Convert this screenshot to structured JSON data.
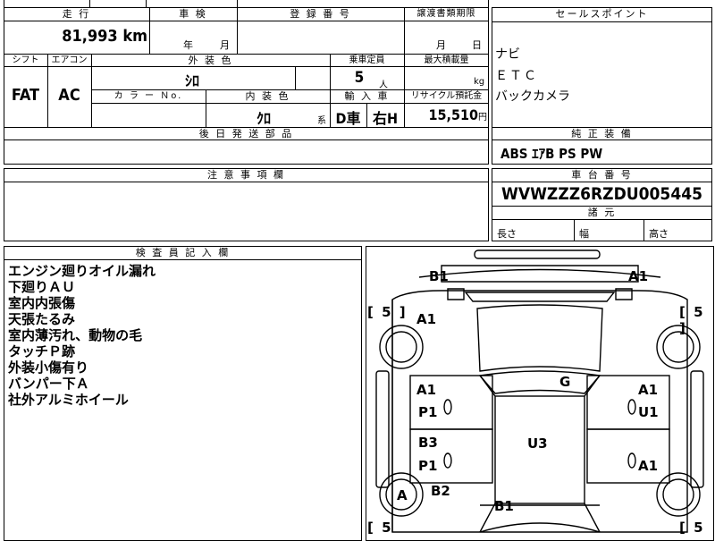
{
  "mileage": {
    "header": "走 行",
    "value": "81,993",
    "unit": "km"
  },
  "inspection": {
    "header": "車 検",
    "year_unit": "年",
    "month_unit": "月"
  },
  "registration": {
    "header": "登 録 番 号"
  },
  "transfer": {
    "header": "譲渡書類期限",
    "month_unit": "月",
    "day_unit": "日"
  },
  "shift": {
    "header": "シフト",
    "value": "FAT"
  },
  "aircon": {
    "header": "エアコン",
    "value": "AC"
  },
  "exterior_color": {
    "header": "外 装 色",
    "value": "ｼﾛ"
  },
  "capacity": {
    "header": "乗車定員",
    "value": "5",
    "unit": "人"
  },
  "max_load": {
    "header": "最大積載量",
    "unit": "kg"
  },
  "color_no": {
    "header": "カ ラ ー Ｎo."
  },
  "interior_color": {
    "header": "内 装 色",
    "value": "ｸﾛ",
    "suffix": "系"
  },
  "import_car": {
    "header": "輸 入 車",
    "value1": "D車",
    "value2": "右H"
  },
  "recycle": {
    "header": "リサイクル預託金",
    "value": "15,510",
    "unit": "円"
  },
  "later_parts": {
    "header": "後 日 発 送 部 品"
  },
  "notes": {
    "header": "注 意 事 項 欄"
  },
  "sales_points": {
    "header": "セールスポイント",
    "items": [
      "ナビ",
      "ＥＴＣ",
      "バックカメラ"
    ]
  },
  "equipment": {
    "header": "純 正 装 備",
    "value": "ABS ｴｱB PS PW"
  },
  "chassis": {
    "header": "車 台 番 号",
    "value": "WVWZZZ6RZDU005445"
  },
  "dimensions": {
    "header": "諸 元",
    "length": "長さ",
    "width": "幅",
    "height": "高さ"
  },
  "inspector": {
    "header": "検 査 員 記 入 欄",
    "lines": [
      "エンジン廻りオイル漏れ",
      "下廻りＡＵ",
      "室内内張傷",
      "天張たるみ",
      "室内薄汚れ、動物の毛",
      "タッチＰ跡",
      "外装小傷有り",
      "バンパー下Ａ",
      "社外アルミホイール"
    ]
  },
  "diagram": {
    "tires": [
      "[ 5 ]",
      "[ 5 ]",
      "[ 5",
      "[ 5"
    ],
    "marks": [
      "B1",
      "A1",
      "A1",
      "G",
      "A1",
      "A1",
      "P1",
      "U1",
      "B3",
      "U3",
      "P1",
      "A1",
      "A",
      "B2",
      "B1"
    ]
  }
}
